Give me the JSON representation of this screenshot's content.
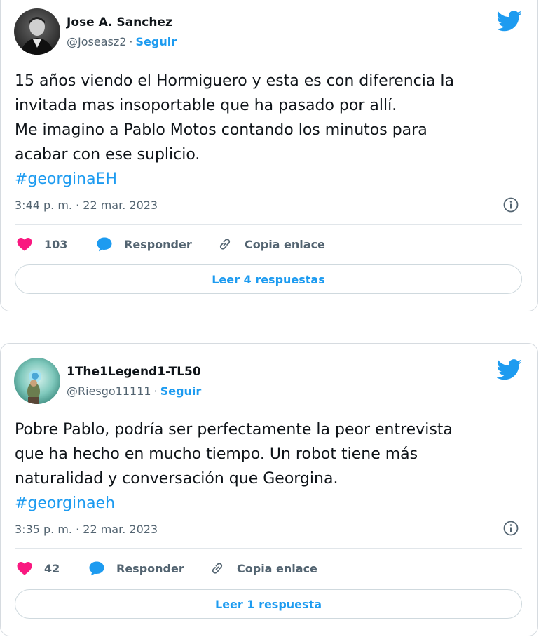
{
  "colors": {
    "accent": "#1d9bf0",
    "heart": "#f91880",
    "muted": "#536471",
    "text": "#0f1419"
  },
  "tweets": [
    {
      "author": "Jose A. Sanchez",
      "handle": "@Joseasz2",
      "separator": "·",
      "follow_label": "Seguir",
      "text": "15 años viendo el Hormiguero y esta es con diferencia la\ninvitada mas insoportable que ha pasado por allí.\nMe imagino a Pablo Motos contando los minutos para\nacabar con ese suplicio.",
      "hashtag": "#georginaEH",
      "timestamp": "3:44 p. m. · 22 mar. 2023",
      "likes": "103",
      "reply_label": "Responder",
      "copy_label": "Copia enlace",
      "read_replies_label": "Leer 4 respuestas",
      "icons": {
        "platform": "twitter-bird-icon",
        "info": "info-icon",
        "like": "heart-icon",
        "reply": "reply-bubble-icon",
        "copy": "link-icon"
      }
    },
    {
      "author": "1The1Legend1-TL50",
      "handle": "@Riesgo11111",
      "separator": "·",
      "follow_label": "Seguir",
      "text": "Pobre Pablo, podría ser perfectamente la peor entrevista\nque ha hecho en mucho tiempo. Un robot tiene más\nnaturalidad y conversación que Georgina.",
      "hashtag": "#georginaeh",
      "timestamp": "3:35 p. m. · 22 mar. 2023",
      "likes": "42",
      "reply_label": "Responder",
      "copy_label": "Copia enlace",
      "read_replies_label": "Leer 1 respuesta",
      "icons": {
        "platform": "twitter-bird-icon",
        "info": "info-icon",
        "like": "heart-icon",
        "reply": "reply-bubble-icon",
        "copy": "link-icon"
      }
    }
  ]
}
